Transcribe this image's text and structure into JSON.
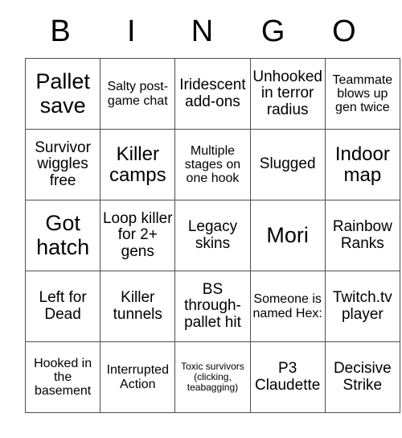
{
  "card": {
    "header_letters": [
      "B",
      "I",
      "N",
      "G",
      "O"
    ],
    "colors": {
      "background": "#ffffff",
      "text": "#000000",
      "border": "#4d4d4d"
    },
    "rows": [
      [
        {
          "text": "Pallet save",
          "size": "xl"
        },
        {
          "text": "Salty post-game chat",
          "size": "sm"
        },
        {
          "text": "Iridescent add-ons",
          "size": "md"
        },
        {
          "text": "Unhooked in terror radius",
          "size": "md"
        },
        {
          "text": "Teammate blows up gen twice",
          "size": "sm"
        }
      ],
      [
        {
          "text": "Survivor wiggles free",
          "size": "md"
        },
        {
          "text": "Killer camps",
          "size": "lg"
        },
        {
          "text": "Multiple stages on one hook",
          "size": "sm"
        },
        {
          "text": "Slugged",
          "size": "md"
        },
        {
          "text": "Indoor map",
          "size": "lg"
        }
      ],
      [
        {
          "text": "Got hatch",
          "size": "xl"
        },
        {
          "text": "Loop killer for 2+ gens",
          "size": "md"
        },
        {
          "text": "Legacy skins",
          "size": "md"
        },
        {
          "text": "Mori",
          "size": "xl"
        },
        {
          "text": "Rainbow Ranks",
          "size": "md"
        }
      ],
      [
        {
          "text": "Left for Dead",
          "size": "md"
        },
        {
          "text": "Killer tunnels",
          "size": "md"
        },
        {
          "text": "BS through-pallet hit",
          "size": "md"
        },
        {
          "text": "Someone is named Hex:",
          "size": "sm"
        },
        {
          "text": "Twitch.tv player",
          "size": "md"
        }
      ],
      [
        {
          "text": "Hooked in the basement",
          "size": "sm"
        },
        {
          "text": "Interrupted Action",
          "size": "sm"
        },
        {
          "text": "Toxic survivors (clicking, teabagging)",
          "size": "xxs"
        },
        {
          "text": "P3 Claudette",
          "size": "md"
        },
        {
          "text": "Decisive Strike",
          "size": "md"
        }
      ]
    ]
  }
}
